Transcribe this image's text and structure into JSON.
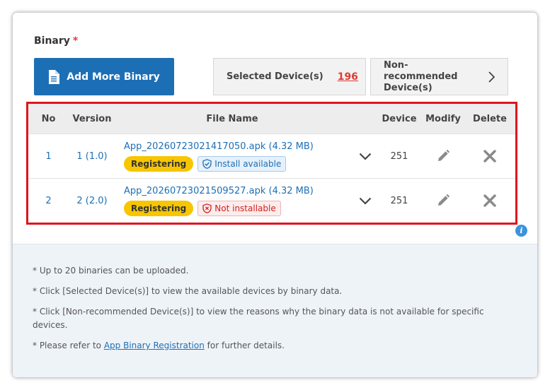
{
  "section": {
    "title": "Binary",
    "required_mark": "*"
  },
  "add_button": {
    "label": "Add More Binary",
    "icon": "document-icon"
  },
  "selected_devices": {
    "label": "Selected Device(s)",
    "count": "196"
  },
  "non_recommended": {
    "line1": "Non-",
    "line2": "recommended",
    "line3": "Device(s)",
    "icon": "chevron-right-icon"
  },
  "table": {
    "headers": {
      "no": "No",
      "version": "Version",
      "file_name": "File Name",
      "device": "Device",
      "modify": "Modify",
      "delete": "Delete"
    },
    "rows": [
      {
        "no": "1",
        "version": "1 (1.0)",
        "file": "App_20260723021417050.apk (4.32 MB)",
        "status": "Registering",
        "install": "Install available",
        "install_state": "ok",
        "device": "251"
      },
      {
        "no": "2",
        "version": "2 (2.0)",
        "file": "App_20260723021509527.apk (4.32 MB)",
        "status": "Registering",
        "install": "Not installable",
        "install_state": "error",
        "device": "251"
      }
    ]
  },
  "info_icon": "i",
  "notes": {
    "n1": "* Up to 20 binaries can be uploaded.",
    "n2": "* Click [Selected Device(s)] to view the available devices by binary data.",
    "n3": "* Click [Non-recommended Device(s)] to view the reasons why the binary data is not available for specific devices.",
    "n4_prefix": "* Please refer to ",
    "n4_link": "App Binary Registration",
    "n4_suffix": " for further details."
  },
  "colors": {
    "primary": "#1d6fb5",
    "accent_red": "#e03a2f",
    "badge_yellow": "#f7c600",
    "highlight_border": "#e0141d"
  }
}
